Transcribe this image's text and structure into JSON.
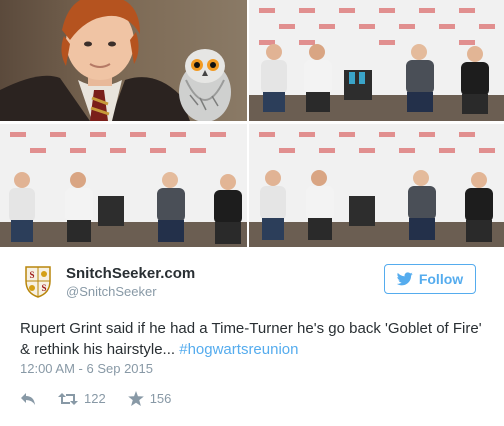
{
  "author": {
    "display_name": "SnitchSeeker.com",
    "handle": "@SnitchSeeker",
    "avatar_icon": "snitchseeker-shield-logo"
  },
  "follow": {
    "label": "Follow",
    "icon": "twitter-bird-icon"
  },
  "tweet": {
    "text": "Rupert Grint said if he had a Time-Turner he's go back 'Goblet of Fire' & rethink his hairstyle... ",
    "hashtag": "#hogwartsreunion",
    "timestamp": "12:00 AM - 6 Sep 2015"
  },
  "actions": {
    "reply_icon": "reply-icon",
    "retweet_icon": "retweet-icon",
    "retweet_count": "122",
    "favorite_icon": "star-icon",
    "favorite_count": "156"
  },
  "colors": {
    "accent": "#55acee",
    "text": "#292f33",
    "muted": "#8899a6"
  },
  "photos": [
    {
      "subject": "portrait-with-owl"
    },
    {
      "subject": "panel-stage"
    },
    {
      "subject": "panel-stage"
    },
    {
      "subject": "panel-stage"
    }
  ]
}
